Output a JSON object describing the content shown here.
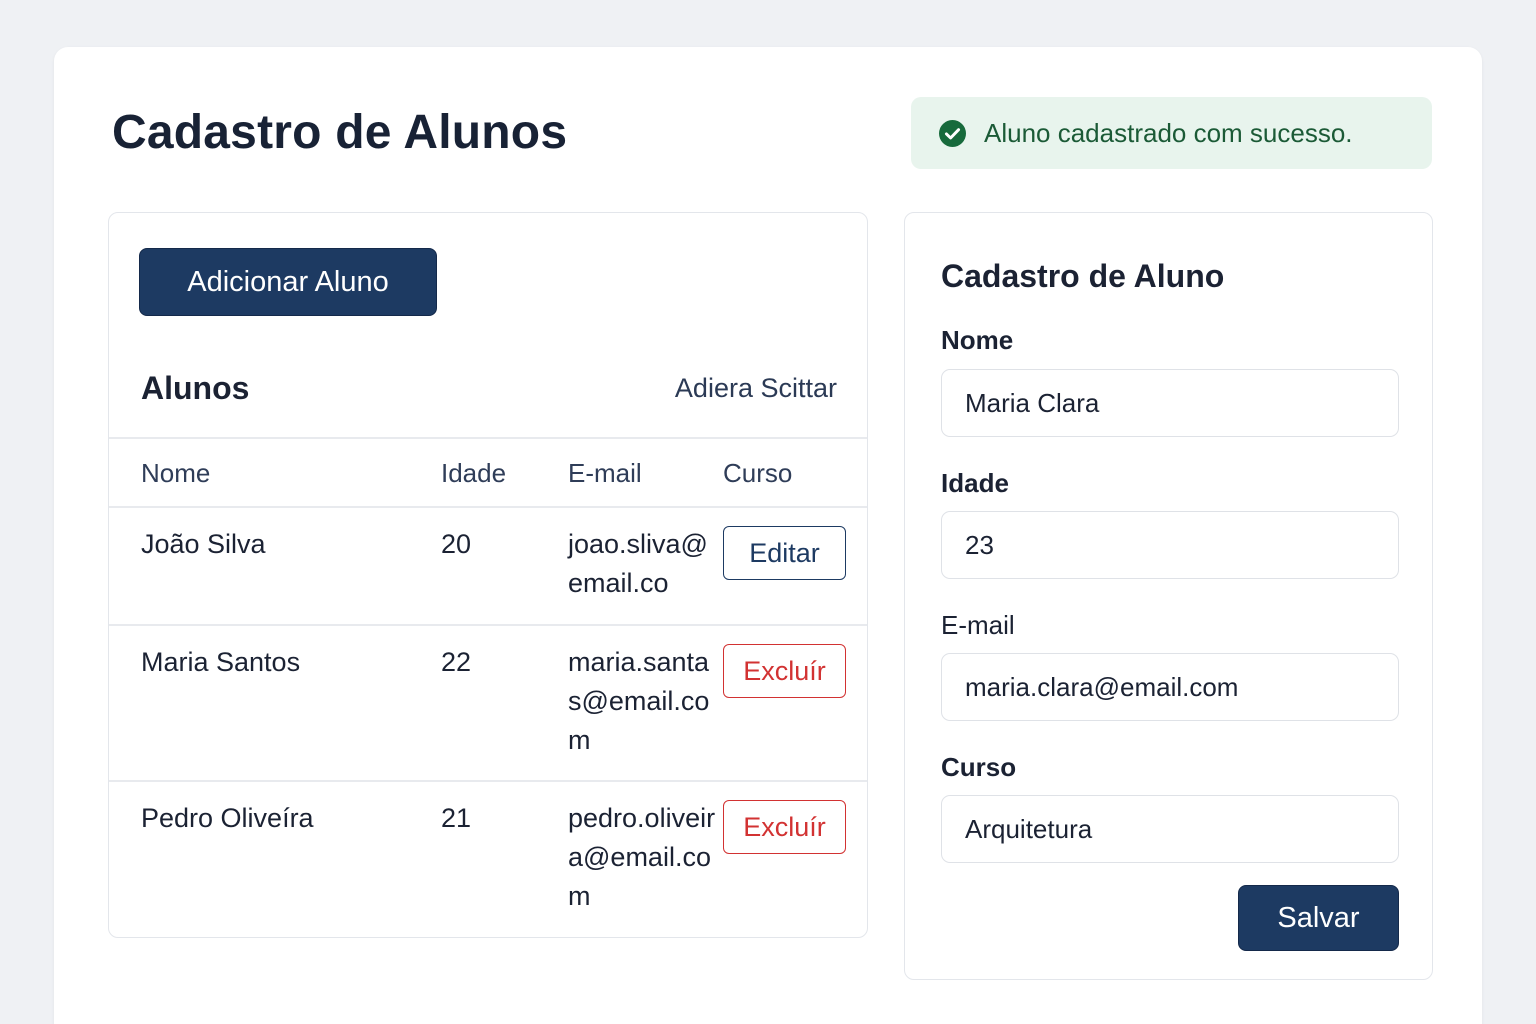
{
  "header": {
    "title": "Cadastro de Alunos"
  },
  "alert": {
    "icon": "check-circle-icon",
    "message": "Aluno cadastrado com sucesso.",
    "color": "#1b5a36",
    "background": "#e8f4ed"
  },
  "list": {
    "add_button": "Adicionar Aluno",
    "heading": "Alunos",
    "header_link": "Adiera  Scittar",
    "columns": [
      "Nome",
      "Idade",
      "E-mail",
      "Curso"
    ],
    "rows": [
      {
        "nome": "João Silva",
        "idade": "20",
        "email": "joao.sliva@email.co",
        "action": "Editar"
      },
      {
        "nome": "Maria Santos",
        "idade": "22",
        "email": "maria.santas@email.com",
        "action": "Excluír"
      },
      {
        "nome": "Pedro Oliveíra",
        "idade": "21",
        "email": "pedro.oliveira@email.com",
        "action": "Excluír"
      }
    ]
  },
  "form": {
    "heading": "Cadastro de Aluno",
    "fields": [
      {
        "label": "Nome",
        "value": "Maria Clara"
      },
      {
        "label": "Idade",
        "value": "23"
      },
      {
        "label": "E-mail",
        "value": "maria.clara@email.com"
      },
      {
        "label": "Curso",
        "value": "Arquitetura"
      }
    ],
    "save_button": "Salvar"
  },
  "colors": {
    "primary": "#1d3a62",
    "danger": "#d23232",
    "success": "#1b5a36"
  }
}
